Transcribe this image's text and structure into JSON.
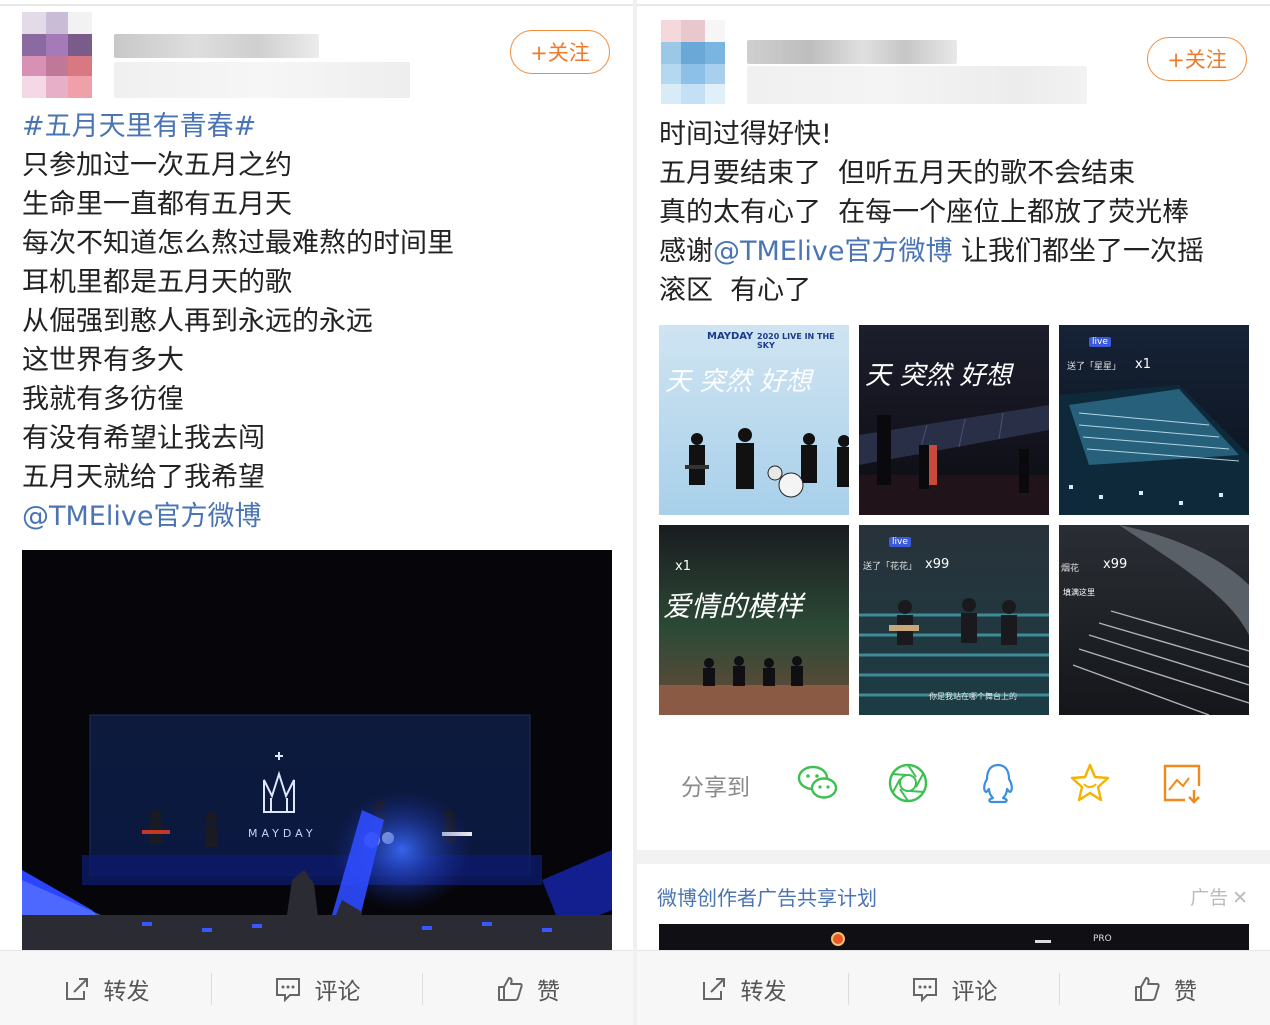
{
  "posts": [
    {
      "follow_label": "+关注",
      "hashtag": "#五月天里有青春#",
      "lines": [
        "只参加过一次五月之约",
        "生命里一直都有五月天",
        "每次不知道怎么熬过最难熬的时间里",
        "耳机里都是五月天的歌",
        "从倔强到憨人再到永远的永远",
        "这世界有多大",
        "我就有多彷徨",
        "有没有希望让我去闯",
        "五月天就给了我希望"
      ],
      "mention": "@TMElive官方微博",
      "photo_logo_text": "MAYDAY",
      "actions": {
        "repost": "转发",
        "comment": "评论",
        "like": "赞"
      }
    },
    {
      "follow_label": "+关注",
      "lines": [
        "时间过得好快!",
        "五月要结束了  但听五月天的歌不会结束",
        "真的太有心了  在每一个座位上都放了荧光棒"
      ],
      "thanks_prefix": "感谢",
      "mention": "@TMElive官方微博",
      "thanks_suffix": " 让我们都坐了一次摇",
      "last_line": "滚区  有心了",
      "images": {
        "tile1": {
          "header_left": "MAYDAY",
          "header_right": "2020 LIVE IN THE SKY",
          "script": "天 突然 好想"
        },
        "tile2": {
          "script": "天 突然 好想"
        },
        "tile3": {
          "badge": "live",
          "gift": "送了「星星」",
          "count": "x1"
        },
        "tile4": {
          "count": "x1",
          "script": "爱情的模样"
        },
        "tile5": {
          "badge": "live",
          "gift": "送了「花花」",
          "count": "x99",
          "subtitle": "你是我站在哪个舞台上的"
        },
        "tile6": {
          "gift": "烟花",
          "count": "x99",
          "subtitle": "填满这里"
        }
      },
      "share_label": "分享到",
      "share_icons": [
        "wechat-icon",
        "moments-icon",
        "qq-icon",
        "favorite-star-icon",
        "save-image-icon"
      ],
      "ad_title": "微博创作者广告共享计划",
      "ad_mark": "广告",
      "ad_strip_text": "PRO",
      "actions": {
        "repost": "转发",
        "comment": "评论",
        "like": "赞"
      }
    }
  ],
  "colors": {
    "link": "#4a74b4",
    "follow": "#f07a2a",
    "share_green": "#3cc051",
    "share_blue": "#3b8fe0",
    "share_gold": "#f5b300",
    "share_orange": "#f08a1c"
  }
}
